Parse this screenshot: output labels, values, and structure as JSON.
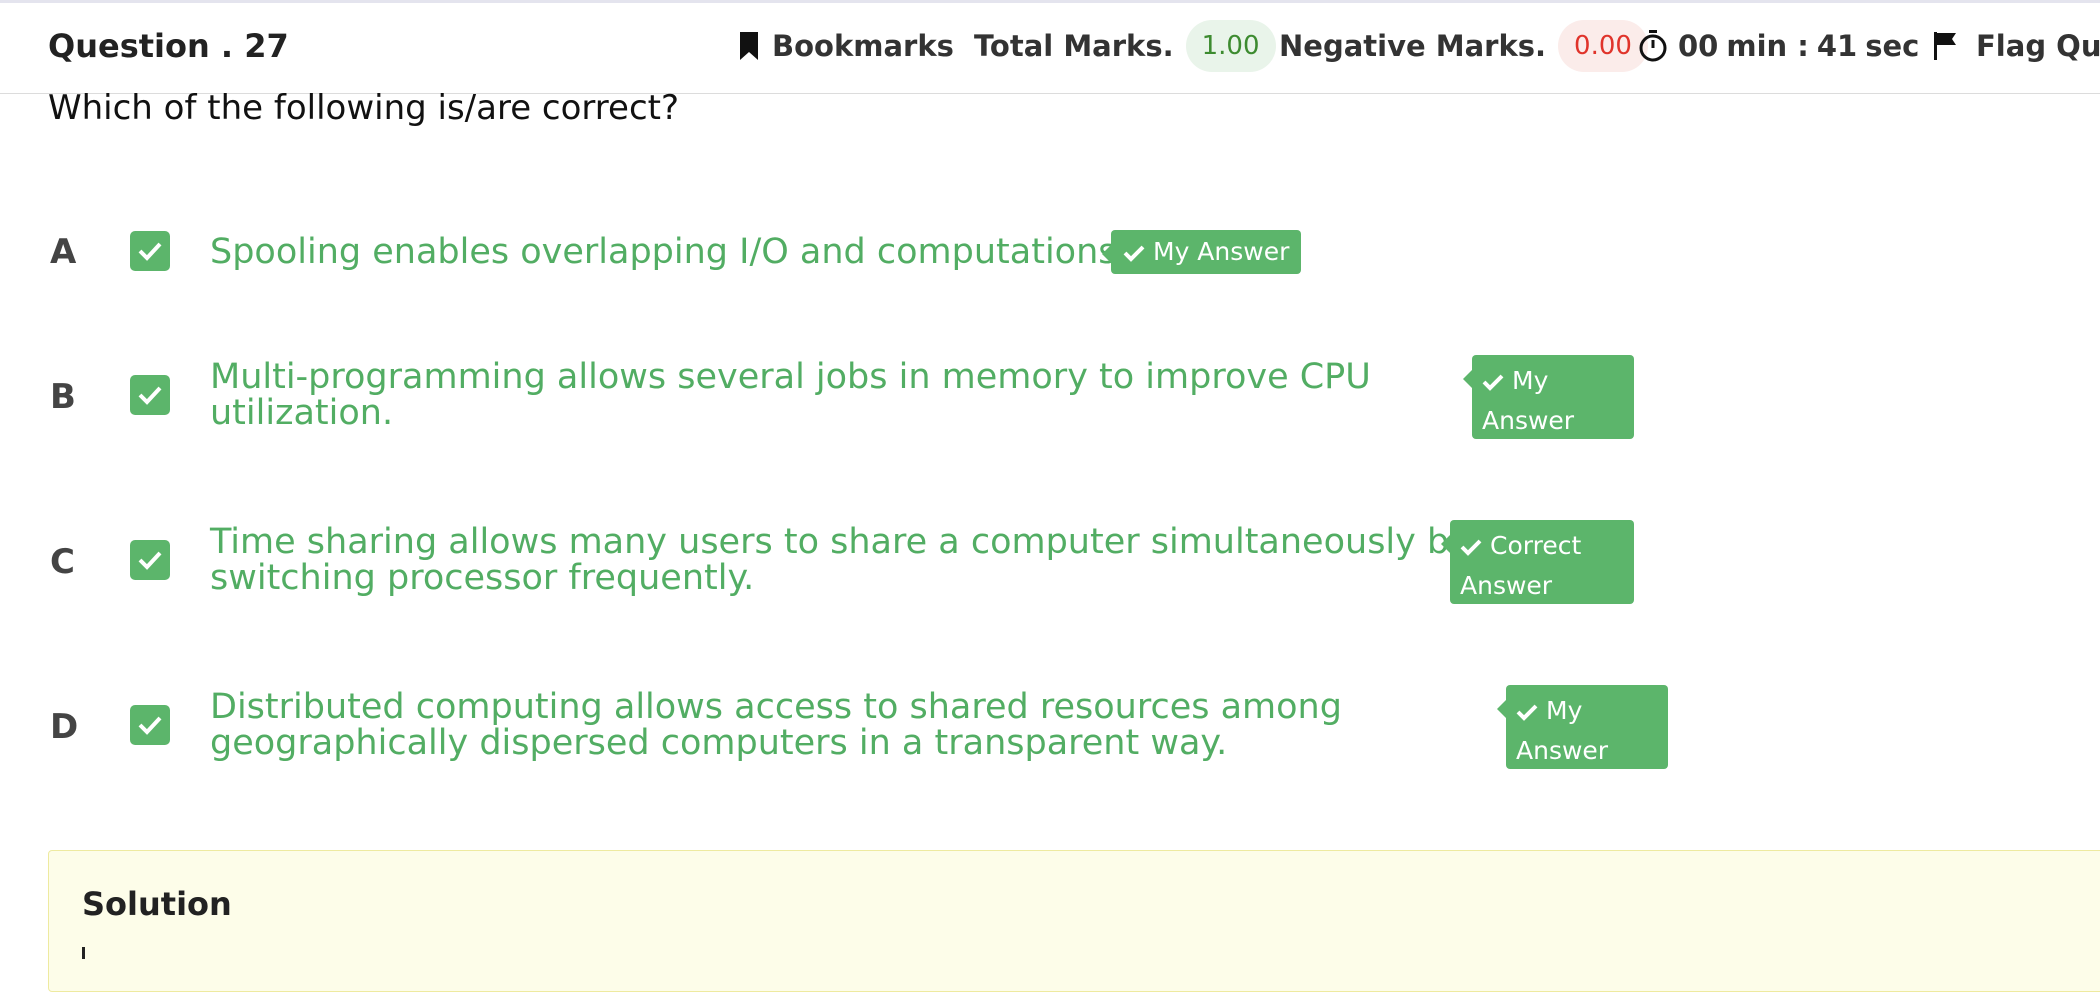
{
  "header": {
    "question_label": "Question . 27",
    "bookmarks_label": "Bookmarks",
    "total_marks_label": "Total Marks.",
    "total_marks_value": "1.00",
    "negative_marks_label": "Negative Marks.",
    "negative_marks_value": "0.00",
    "timer": {
      "minutes": "00",
      "min_unit": "min :",
      "seconds": "41",
      "sec_unit": "sec"
    },
    "flag_label": "Flag Que",
    "colors": {
      "positive": "#3d8b30",
      "negative": "#e0342b",
      "accent_green": "#5cb56b"
    }
  },
  "question": {
    "text": "Which of the following is/are correct?"
  },
  "options": [
    {
      "letter": "A",
      "checked": true,
      "lines": [
        "Spooling enables overlapping I/O and computations."
      ],
      "tag_lines": [
        "My Answer"
      ]
    },
    {
      "letter": "B",
      "checked": true,
      "lines": [
        "Multi-programming allows several jobs in memory to improve CPU",
        "utilization."
      ],
      "tag_lines": [
        "My",
        "Answer"
      ]
    },
    {
      "letter": "C",
      "checked": true,
      "lines": [
        "Time sharing allows many users to share a computer simultaneously by",
        "switching processor frequently."
      ],
      "tag_lines": [
        "Correct",
        "Answer"
      ]
    },
    {
      "letter": "D",
      "checked": true,
      "lines": [
        "Distributed computing allows access to shared resources among",
        "geographically dispersed computers in a transparent way."
      ],
      "tag_lines": [
        "My",
        "Answer"
      ]
    }
  ],
  "solution": {
    "title": "Solution"
  }
}
